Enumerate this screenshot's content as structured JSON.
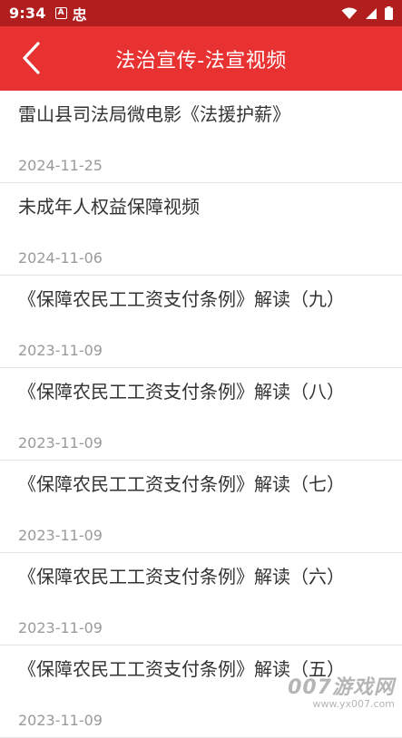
{
  "status_bar": {
    "time": "9:34",
    "notif_a": "A",
    "notif_b": "忠"
  },
  "header": {
    "title": "法治宣传-法宣视频",
    "background": "#e83232"
  },
  "list": {
    "items": [
      {
        "title": "雷山县司法局微电影《法援护薪》",
        "date": "2024-11-25"
      },
      {
        "title": "未成年人权益保障视频",
        "date": "2024-11-06"
      },
      {
        "title": "《保障农民工工资支付条例》解读（九）",
        "date": "2023-11-09"
      },
      {
        "title": "《保障农民工工资支付条例》解读（八）",
        "date": "2023-11-09"
      },
      {
        "title": "《保障农民工工资支付条例》解读（七）",
        "date": "2023-11-09"
      },
      {
        "title": "《保障农民工工资支付条例》解读（六）",
        "date": "2023-11-09"
      },
      {
        "title": "《保障农民工工资支付条例》解读（五）",
        "date": "2023-11-09"
      }
    ]
  },
  "watermark": {
    "brand": "007游戏网",
    "url": "www.yx007.com"
  },
  "colors": {
    "status_bar": "#b01e1e",
    "title_text": "#333333",
    "date_text": "#9a9a9a"
  }
}
